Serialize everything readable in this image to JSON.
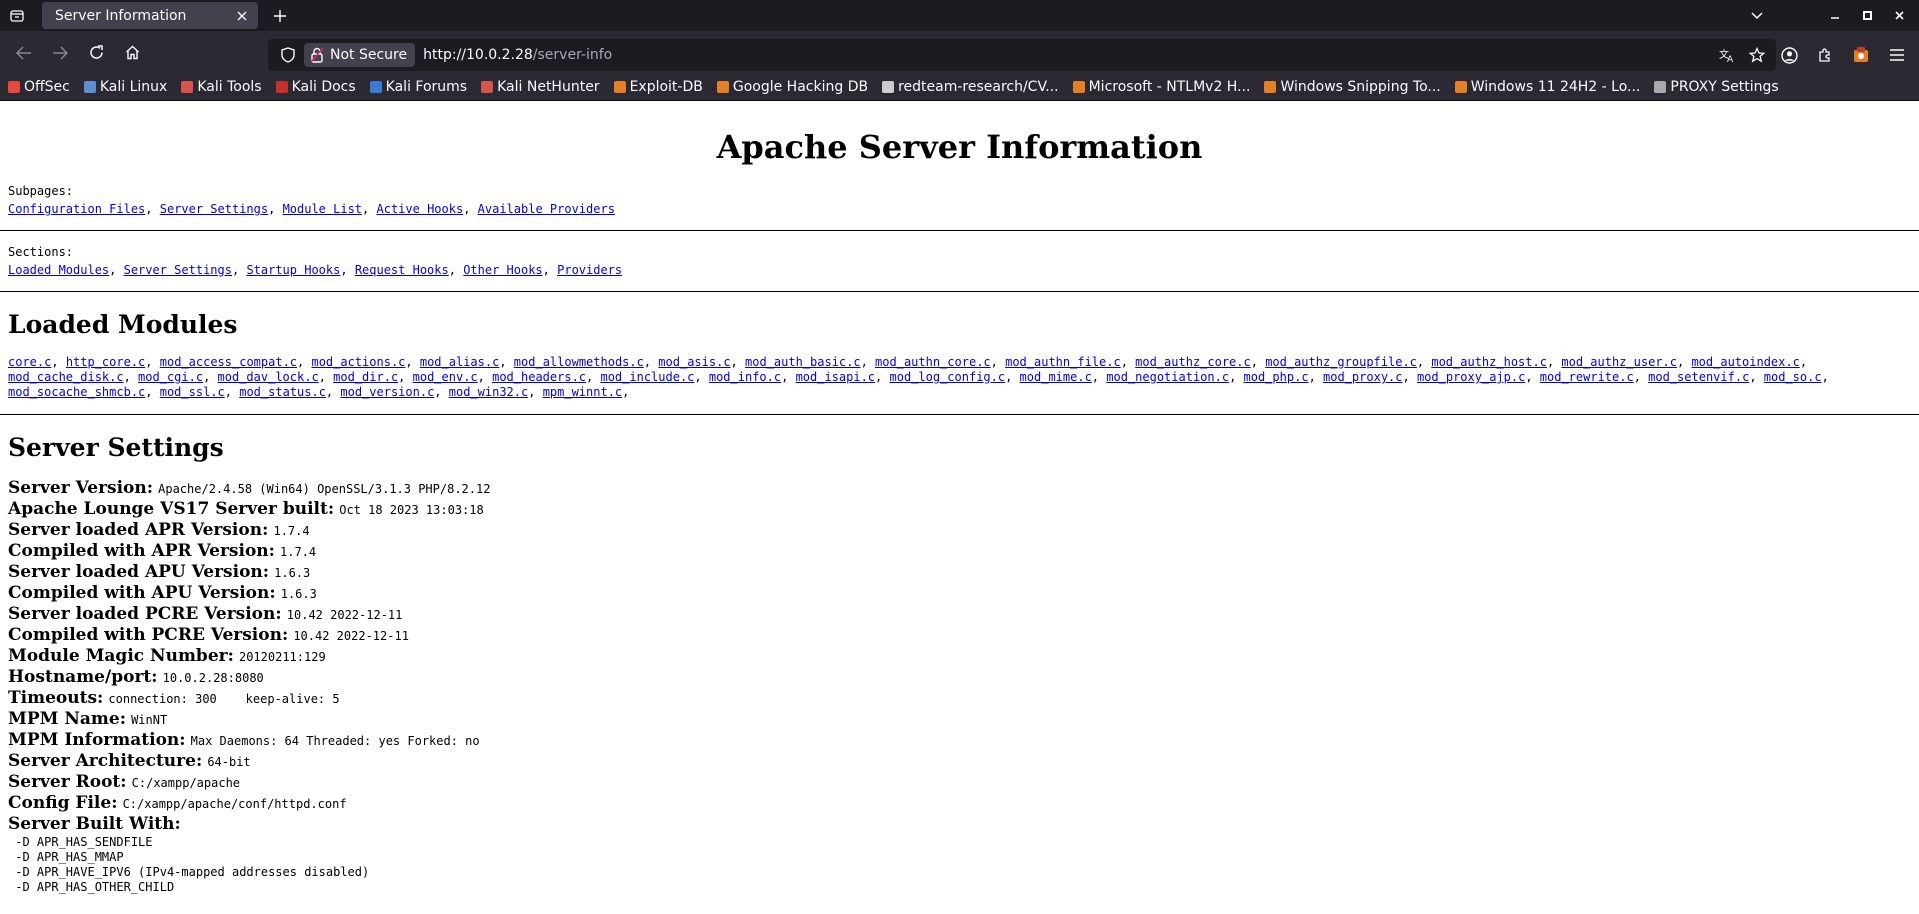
{
  "tab": {
    "title": "Server Information"
  },
  "urlbar": {
    "security_label": "Not Secure",
    "url_host": "http://10.0.2.28",
    "url_path": "/server-info"
  },
  "bookmarks": [
    {
      "label": "OffSec",
      "color": "#e8473b"
    },
    {
      "label": "Kali Linux",
      "color": "#5c8dd6"
    },
    {
      "label": "Kali Tools",
      "color": "#d9534f"
    },
    {
      "label": "Kali Docs",
      "color": "#c9302c"
    },
    {
      "label": "Kali Forums",
      "color": "#3a7bd5"
    },
    {
      "label": "Kali NetHunter",
      "color": "#d9534f"
    },
    {
      "label": "Exploit-DB",
      "color": "#e67e22"
    },
    {
      "label": "Google Hacking DB",
      "color": "#e67e22"
    },
    {
      "label": "redteam-research/CV...",
      "color": "#cccccc"
    },
    {
      "label": "Microsoft - NTLMv2 H...",
      "color": "#e67e22"
    },
    {
      "label": "Windows Snipping To...",
      "color": "#e67e22"
    },
    {
      "label": "Windows 11 24H2 - Lo...",
      "color": "#e67e22"
    },
    {
      "label": "PROXY Settings",
      "color": "#aaaaaa"
    }
  ],
  "page": {
    "title": "Apache Server Information",
    "subpages_label": "Subpages:",
    "subpages": [
      "Configuration Files",
      "Server Settings",
      "Module List",
      "Active Hooks",
      "Available Providers"
    ],
    "sections_label": "Sections:",
    "sections": [
      "Loaded Modules",
      "Server Settings",
      "Startup Hooks",
      "Request Hooks",
      "Other Hooks",
      "Providers"
    ],
    "loaded_modules_heading": "Loaded Modules",
    "modules": [
      "core.c",
      "http_core.c",
      "mod_access_compat.c",
      "mod_actions.c",
      "mod_alias.c",
      "mod_allowmethods.c",
      "mod_asis.c",
      "mod_auth_basic.c",
      "mod_authn_core.c",
      "mod_authn_file.c",
      "mod_authz_core.c",
      "mod_authz_groupfile.c",
      "mod_authz_host.c",
      "mod_authz_user.c",
      "mod_autoindex.c",
      "mod_cache_disk.c",
      "mod_cgi.c",
      "mod_dav_lock.c",
      "mod_dir.c",
      "mod_env.c",
      "mod_headers.c",
      "mod_include.c",
      "mod_info.c",
      "mod_isapi.c",
      "mod_log_config.c",
      "mod_mime.c",
      "mod_negotiation.c",
      "mod_php.c",
      "mod_proxy.c",
      "mod_proxy_ajp.c",
      "mod_rewrite.c",
      "mod_setenvif.c",
      "mod_so.c",
      "mod_socache_shmcb.c",
      "mod_ssl.c",
      "mod_status.c",
      "mod_version.c",
      "mod_win32.c",
      "mpm_winnt.c"
    ],
    "server_settings_heading": "Server Settings",
    "settings": [
      {
        "label": "Server Version:",
        "value": "Apache/2.4.58 (Win64) OpenSSL/3.1.3 PHP/8.2.12"
      },
      {
        "label": "Apache Lounge VS17 Server built:",
        "value": "Oct 18 2023 13:03:18"
      },
      {
        "label": "Server loaded APR Version:",
        "value": "1.7.4"
      },
      {
        "label": "Compiled with APR Version:",
        "value": "1.7.4"
      },
      {
        "label": "Server loaded APU Version:",
        "value": "1.6.3"
      },
      {
        "label": "Compiled with APU Version:",
        "value": "1.6.3"
      },
      {
        "label": "Server loaded PCRE Version:",
        "value": "10.42 2022-12-11"
      },
      {
        "label": "Compiled with PCRE Version:",
        "value": "10.42 2022-12-11"
      },
      {
        "label": "Module Magic Number:",
        "value": "20120211:129"
      },
      {
        "label": "Hostname/port:",
        "value": "10.0.2.28:8080"
      },
      {
        "label": "Timeouts:",
        "value": "connection: 300    keep-alive: 5"
      },
      {
        "label": "MPM Name:",
        "value": "WinNT"
      },
      {
        "label": "MPM Information:",
        "value": "Max Daemons: 64 Threaded: yes Forked: no"
      },
      {
        "label": "Server Architecture:",
        "value": "64-bit"
      },
      {
        "label": "Server Root:",
        "value": "C:/xampp/apache"
      },
      {
        "label": "Config File:",
        "value": "C:/xampp/apache/conf/httpd.conf"
      },
      {
        "label": "Server Built With:",
        "value": ""
      }
    ],
    "built_with": [
      " -D APR_HAS_SENDFILE",
      " -D APR_HAS_MMAP",
      " -D APR_HAVE_IPV6 (IPv4-mapped addresses disabled)",
      " -D APR_HAS_OTHER_CHILD"
    ]
  }
}
